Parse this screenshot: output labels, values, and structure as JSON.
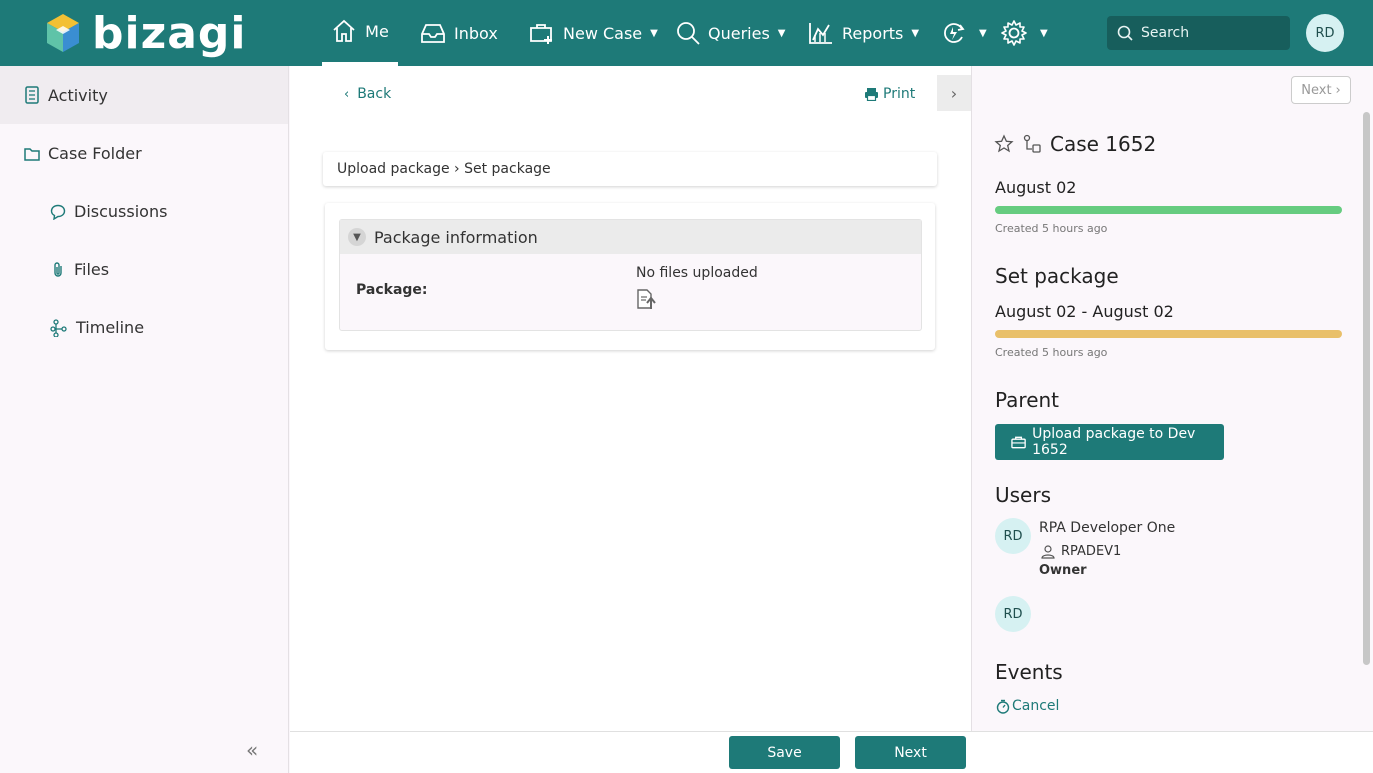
{
  "brand": {
    "name": "bizagi"
  },
  "nav": {
    "me": "Me",
    "inbox": "Inbox",
    "new_case": "New Case",
    "queries": "Queries",
    "reports": "Reports",
    "search_placeholder": "Search",
    "user_initials": "RD"
  },
  "sidebar": {
    "items": [
      {
        "label": "Activity",
        "icon": "activity-icon",
        "selected": true
      },
      {
        "label": "Case Folder",
        "icon": "folder-icon"
      },
      {
        "label": "Discussions",
        "icon": "chat-icon"
      },
      {
        "label": "Files",
        "icon": "paperclip-icon"
      },
      {
        "label": "Timeline",
        "icon": "timeline-icon"
      }
    ]
  },
  "main": {
    "back_label": "Back",
    "print_label": "Print",
    "breadcrumb": "Upload package › Set package",
    "group_title": "Package information",
    "package_label": "Package:",
    "package_value": "No files uploaded"
  },
  "footer": {
    "save_label": "Save",
    "next_label": "Next"
  },
  "right_panel": {
    "next_label": "Next",
    "case_title": "Case 1652",
    "case_date": "August 02",
    "case_created": "Created 5 hours ago",
    "case_progress_color": "#66cc80",
    "task_title": "Set package",
    "task_dates": "August 02 - August 02",
    "task_created": "Created 5 hours ago",
    "task_progress_color": "#e9c06a",
    "parent_title": "Parent",
    "parent_button": "Upload package to Dev 1652",
    "users_title": "Users",
    "users": [
      {
        "initials": "RD",
        "name": "RPA Developer One",
        "login": "RPADEV1",
        "role": "Owner"
      },
      {
        "initials": "RD"
      }
    ],
    "events_title": "Events",
    "cancel_label": "Cancel"
  },
  "colors": {
    "brand_teal": "#1e7a78"
  }
}
